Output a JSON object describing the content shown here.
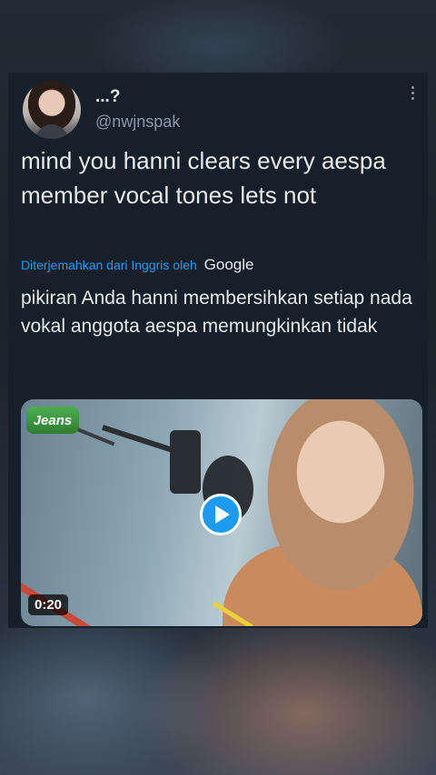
{
  "tweet": {
    "display_name": "...?",
    "handle": "@nwjnspak",
    "text": "mind you hanni clears every aespa member vocal tones lets not",
    "translation_notice": "Diterjemahkan dari Inggris oleh",
    "translation_provider": "Google",
    "translated_text": "pikiran Anda hanni membersihkan setiap nada vokal anggota aespa memungkinkan tidak"
  },
  "media": {
    "type": "video",
    "duration": "0:20",
    "overlay_logo": "Jeans"
  },
  "icons": {
    "more": "more-vertical-icon",
    "play": "play-icon"
  },
  "colors": {
    "background": "#15202b",
    "text": "#e7e9ea",
    "secondary_text": "#8b98a5",
    "accent": "#1d9bf0"
  }
}
